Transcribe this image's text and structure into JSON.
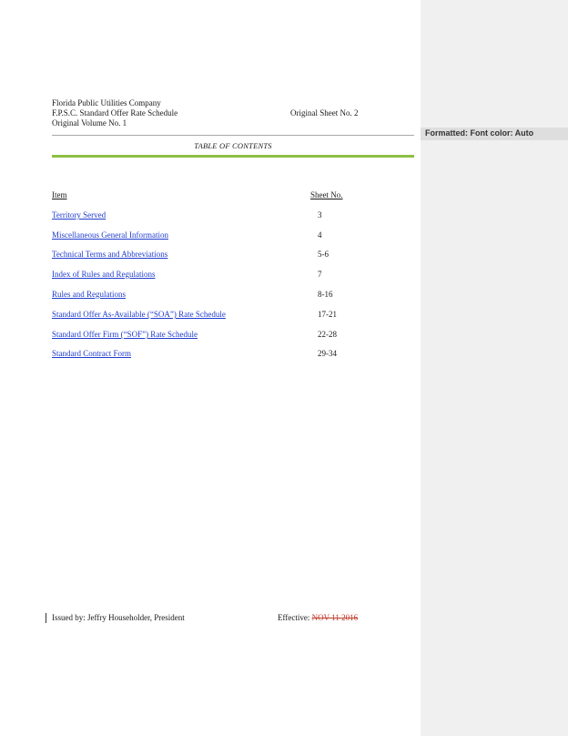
{
  "header": {
    "company": "Florida Public Utilities Company",
    "schedule": "F.P.S.C. Standard Offer Rate Schedule",
    "volume": "Original Volume No. 1",
    "sheet": "Original Sheet No. 2"
  },
  "toc": {
    "title": "TABLE OF CONTENTS",
    "col_item": "Item",
    "col_sheet": "Sheet No.",
    "rows": [
      {
        "label": "Territory Served",
        "sheet": "3"
      },
      {
        "label": "Miscellaneous General Information",
        "sheet": "4"
      },
      {
        "label": "Technical Terms and Abbreviations",
        "sheet": "5-6"
      },
      {
        "label": "Index of Rules and Regulations",
        "sheet": "7"
      },
      {
        "label": "Rules and Regulations",
        "sheet": "8-16"
      },
      {
        "label": "Standard Offer As-Available (“SOA”) Rate Schedule",
        "sheet": "17-21"
      },
      {
        "label": "Standard Offer Firm (“SOF”) Rate Schedule",
        "sheet": "22-28"
      },
      {
        "label": "Standard Contract Form",
        "sheet": "29-34"
      }
    ]
  },
  "footer": {
    "issued_by": "Issued by: Jeffry Householder, President",
    "effective_label": "Effective: ",
    "effective_deleted": "NOV 11 2016"
  },
  "comments": {
    "label": "Formatted: Font color: Auto"
  },
  "colors": {
    "link": "#1f3bcc",
    "accent_rule": "#8dbf45",
    "deleted_text": "#c0392b",
    "comment_pane": "#f0f0f0"
  }
}
